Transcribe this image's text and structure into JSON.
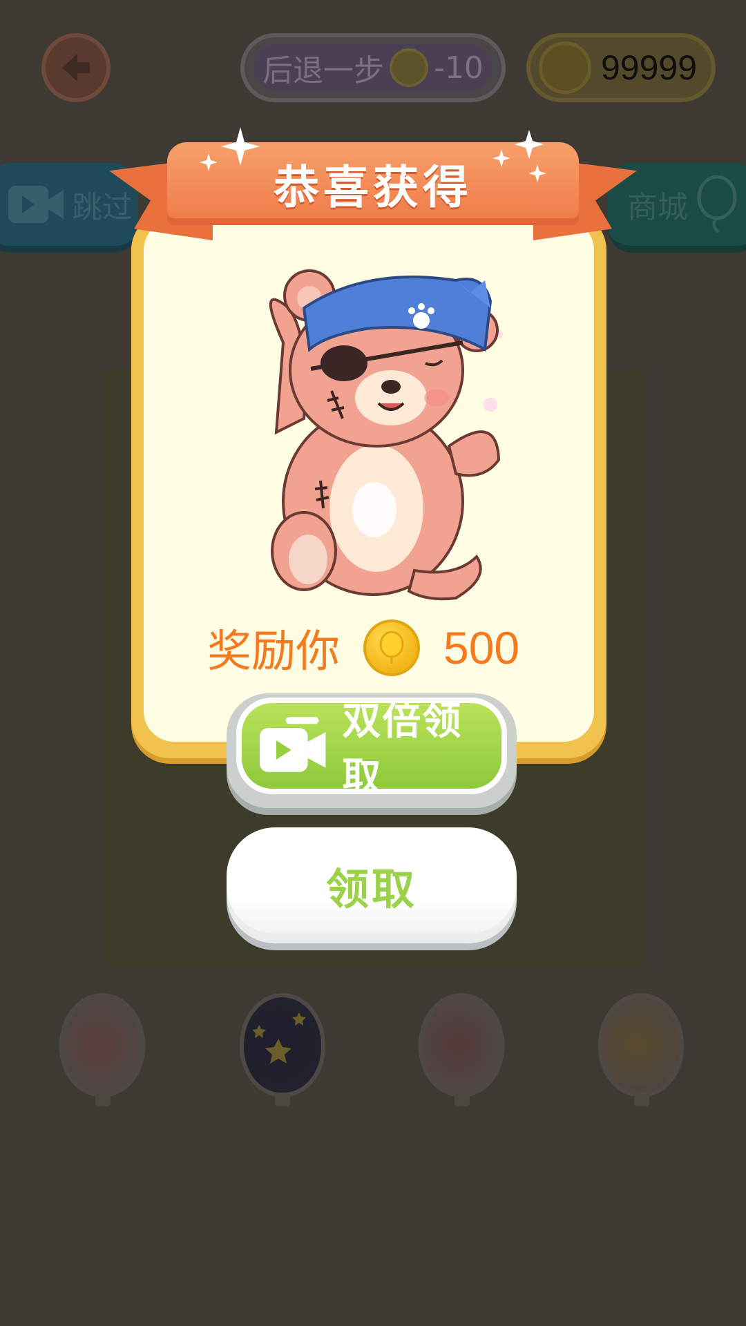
{
  "topbar": {
    "undo_label": "后退一步",
    "undo_cost": "-10",
    "coin_balance": "99999"
  },
  "side_buttons": {
    "skip_label": "跳过",
    "shop_label": "商城"
  },
  "popup": {
    "title": "恭喜获得",
    "reward_label": "奖励你",
    "reward_amount": "500",
    "double_button_label": "双倍领取",
    "claim_button_label": "领取"
  },
  "balloons": [
    "dots-balloon",
    "stars-balloon",
    "hearts-balloon",
    "giraffe-balloon"
  ],
  "colors": {
    "accent_orange": "#f57a1f",
    "ribbon": "#ef7a47",
    "card_border": "#f1c24d",
    "card_fill": "#fffde3",
    "green_button": "#a5d64a"
  }
}
